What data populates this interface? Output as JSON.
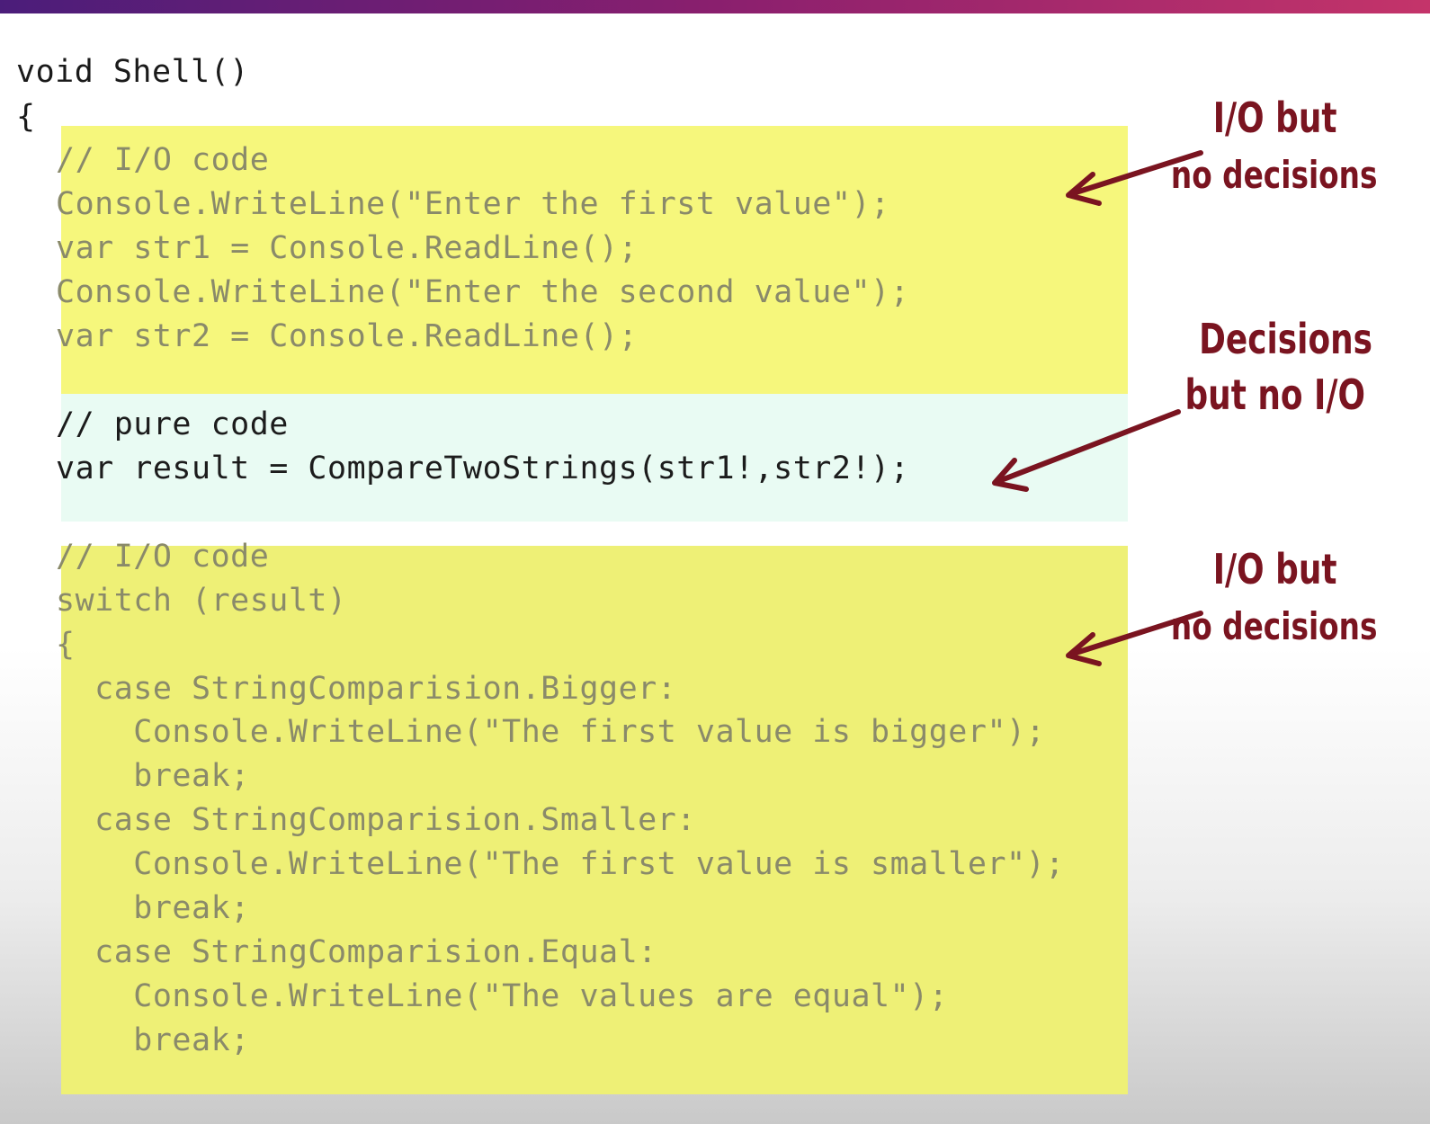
{
  "colors": {
    "top_bar_gradient": [
      "#4b1d7a",
      "#8a1f6e",
      "#c4346a"
    ],
    "io_highlight": "#f6f77c",
    "pure_highlight": "#e9fbf3",
    "annotation": "#7a1420"
  },
  "code": {
    "header": "void Shell()",
    "open_brace": "{",
    "io_block_1": [
      "// I/O code",
      "Console.WriteLine(\"Enter the first value\");",
      "var str1 = Console.ReadLine();",
      "Console.WriteLine(\"Enter the second value\");",
      "var str2 = Console.ReadLine();"
    ],
    "pure_block": [
      "// pure code",
      "var result = CompareTwoStrings(str1!,str2!);"
    ],
    "io_block_2": [
      "// I/O code",
      "switch (result)",
      "{",
      "  case StringComparision.Bigger:",
      "    Console.WriteLine(\"The first value is bigger\");",
      "    break;",
      "  case StringComparision.Smaller:",
      "    Console.WriteLine(\"The first value is smaller\");",
      "    break;",
      "  case StringComparision.Equal:",
      "    Console.WriteLine(\"The values are equal\");",
      "    break;"
    ]
  },
  "annotations": {
    "top": {
      "line1": "I/O but",
      "line2": "no decisions"
    },
    "middle": {
      "line1": "Decisions",
      "line2": "but no I/O"
    },
    "bottom": {
      "line1": "I/O but",
      "line2": "no decisions"
    }
  }
}
